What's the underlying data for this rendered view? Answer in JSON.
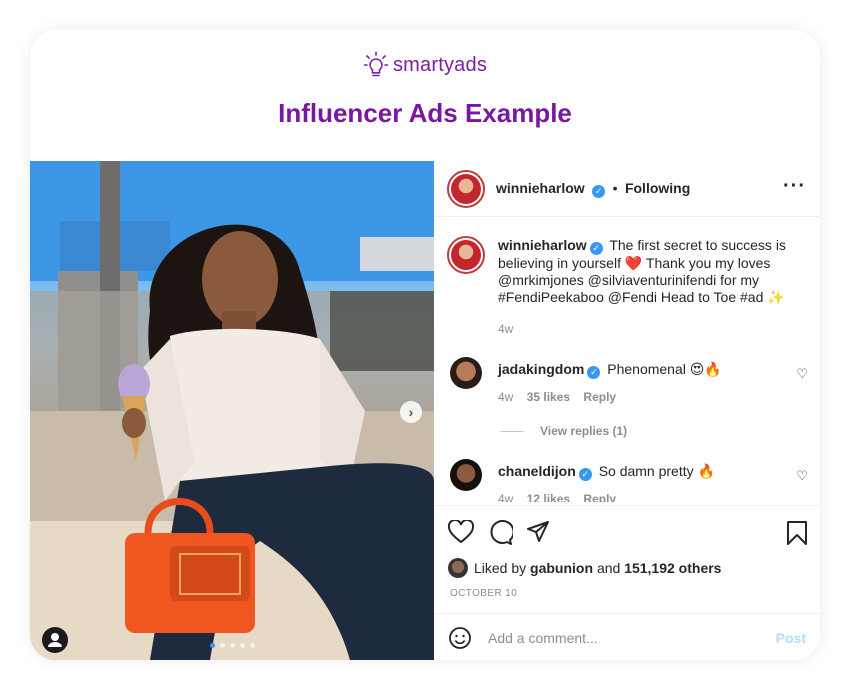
{
  "brand": {
    "name": "smartyads",
    "color": "#7a1fa6"
  },
  "page_title": "Influencer Ads Example",
  "post_header": {
    "username": "winnieharlow",
    "separator": "•",
    "follow_status": "Following",
    "more_icon": "more-horizontal-icon"
  },
  "caption": {
    "username": "winnieharlow",
    "text": "The first secret to success is believing in yourself ❤️ Thank you my loves @mrkimjones @silviaventurinifendi for my #FendiPeekaboo @Fendi Head to Toe #ad ✨",
    "time": "4w"
  },
  "comments": [
    {
      "username": "jadakingdom",
      "text": "Phenomenal 😍🔥",
      "time": "4w",
      "likes": "35 likes",
      "reply": "Reply",
      "view_replies": "View replies (1)"
    },
    {
      "username": "chaneldijon",
      "text": "So damn pretty 🔥",
      "time": "4w",
      "likes": "12 likes",
      "reply": "Reply"
    }
  ],
  "likes": {
    "prefix": "Liked by",
    "user": "gabunion",
    "and": "and",
    "count": "151,192 others"
  },
  "post_date": "OCTOBER 10",
  "comment_box": {
    "placeholder": "Add a comment...",
    "post_label": "Post"
  },
  "carousel": {
    "slide_count": 5,
    "active_index": 0,
    "accent": "#3897f0"
  }
}
